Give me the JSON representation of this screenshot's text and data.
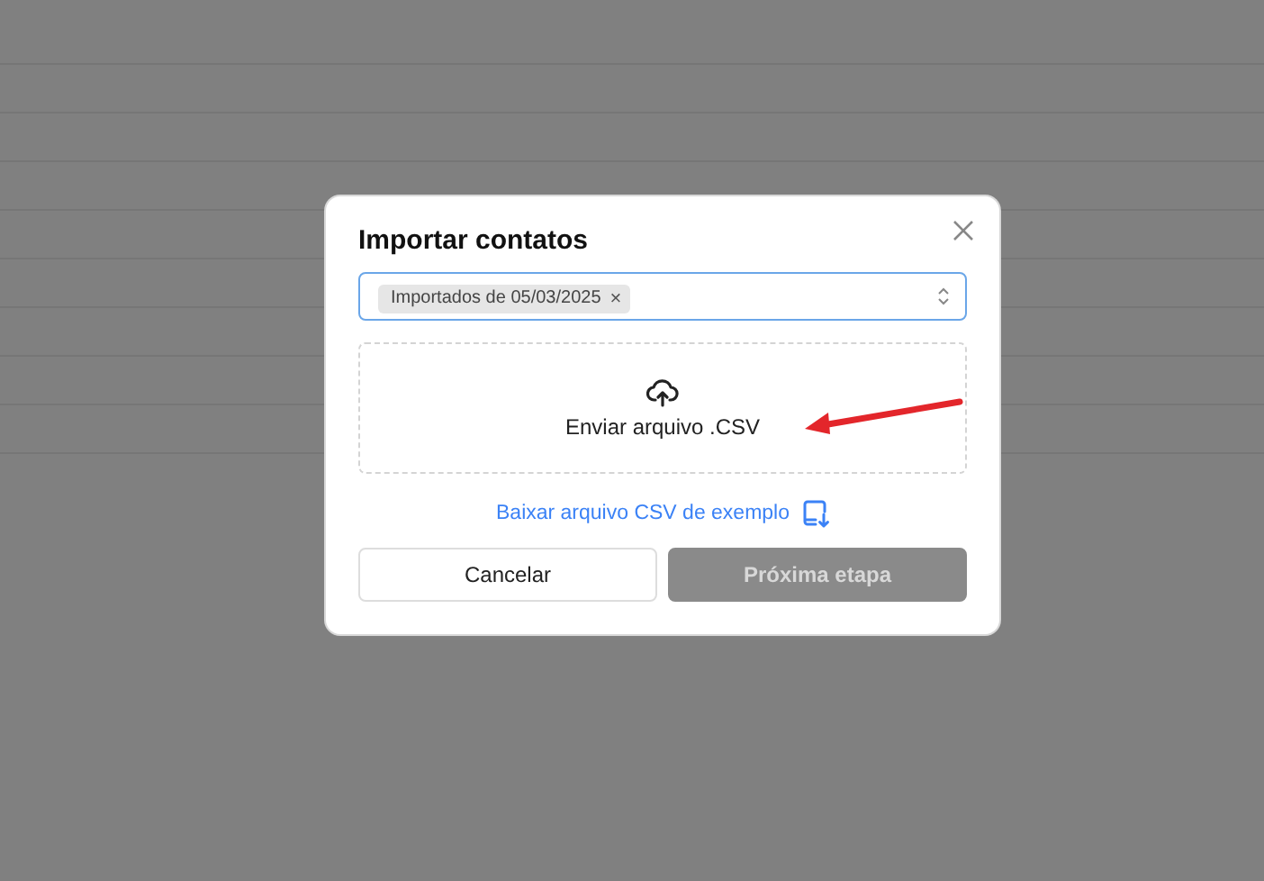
{
  "dialog": {
    "title": "Importar contatos",
    "tag_field": {
      "tags": [
        {
          "label": "Importados de 05/03/2025",
          "remove": "×"
        }
      ]
    },
    "upload": {
      "label": "Enviar arquivo .CSV"
    },
    "download_link": "Baixar arquivo CSV de exemplo",
    "buttons": [
      {
        "kind": "secondary",
        "label": "Cancelar",
        "disabled": false
      },
      {
        "kind": "primary",
        "label": "Próxima etapa",
        "disabled": true
      }
    ]
  }
}
